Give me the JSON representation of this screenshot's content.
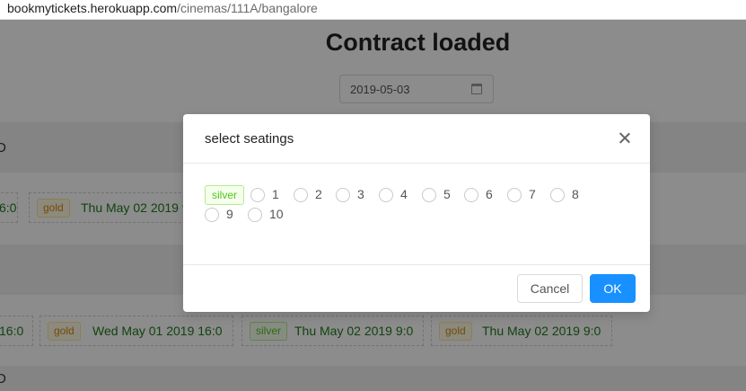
{
  "browser": {
    "url_domain": "bookmytickets.herokuapp.com",
    "url_path": "/cinemas/111A/bangalore"
  },
  "page": {
    "title": "Contract loaded",
    "date_value": "2019-05-03",
    "band1_label": "D",
    "band3_label": "D"
  },
  "shows_row1": [
    {
      "tag": "",
      "text": "6:0"
    },
    {
      "tag": "gold",
      "text": "Thu May 02 2019 9"
    }
  ],
  "shows_row2": [
    {
      "tag": "",
      "text": "16:0"
    },
    {
      "tag": "gold",
      "text": "Wed May 01 2019 16:0"
    },
    {
      "tag": "silver",
      "text": "Thu May 02 2019 9:0"
    },
    {
      "tag": "gold",
      "text": "Thu May 02 2019 9:0"
    }
  ],
  "modal": {
    "title": "select seatings",
    "category_tag": "silver",
    "seats": [
      "1",
      "2",
      "3",
      "4",
      "5",
      "6",
      "7",
      "8",
      "9",
      "10"
    ],
    "cancel_label": "Cancel",
    "ok_label": "OK"
  },
  "colors": {
    "primary": "#1890ff",
    "gold_tag": "#d48806",
    "silver_tag": "#52c41a",
    "show_text": "#1e7b1e"
  }
}
